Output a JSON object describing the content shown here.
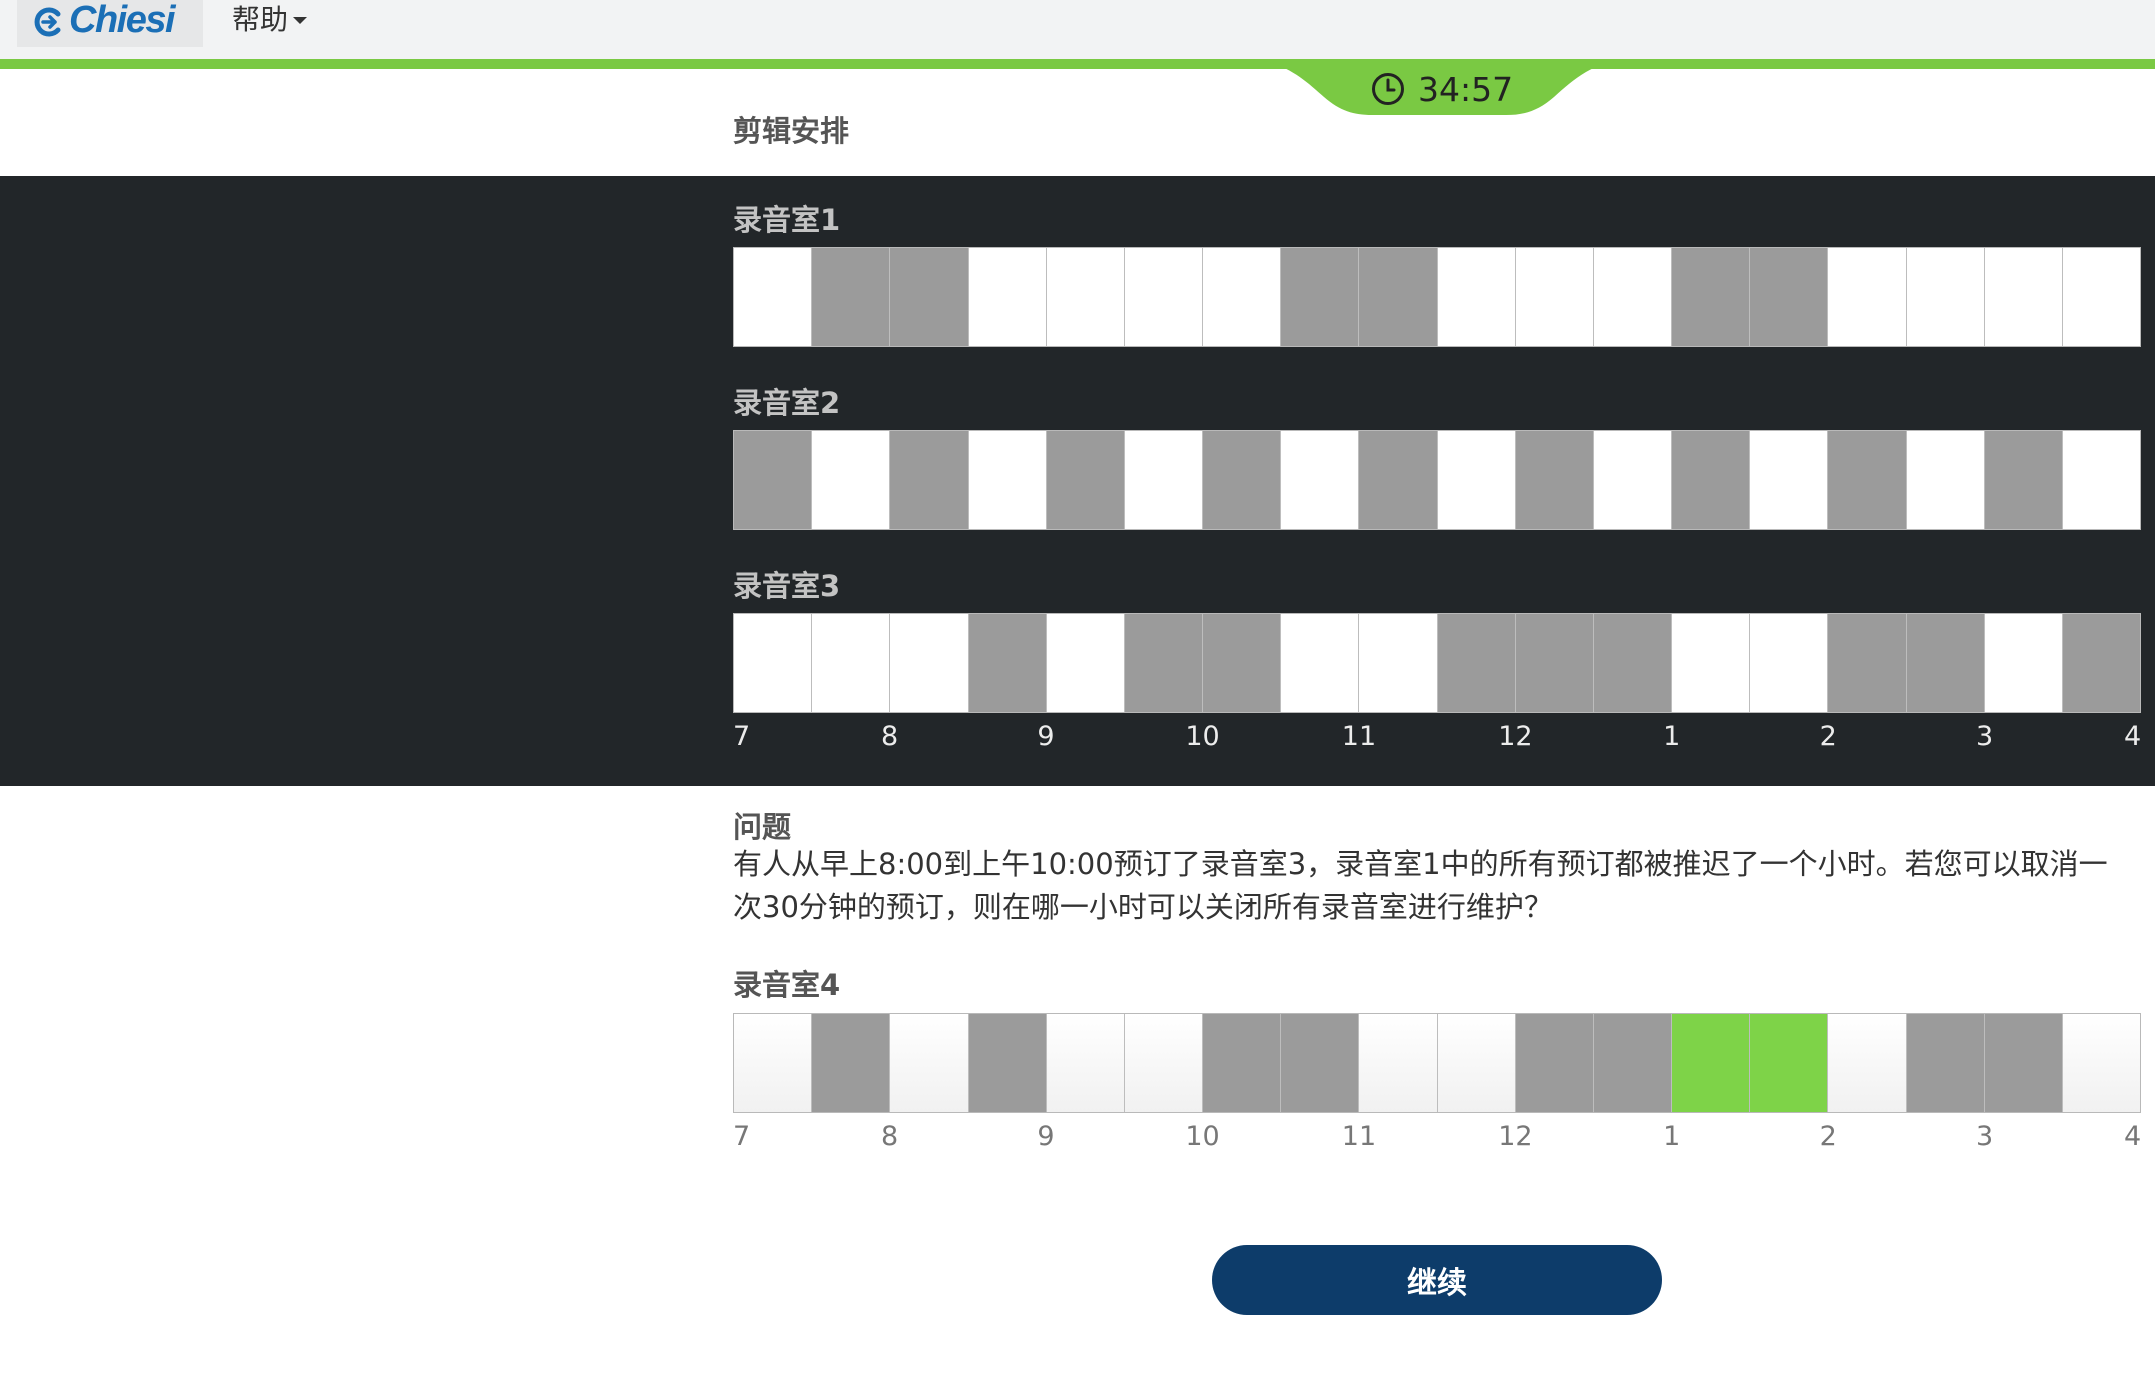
{
  "header": {
    "logo_text": "Chiesi",
    "help_menu_label": "帮助",
    "timer": "34:57"
  },
  "page_title": "剪辑安排",
  "hour_labels": [
    "7",
    "8",
    "9",
    "10",
    "11",
    "12",
    "1",
    "2",
    "3",
    "4"
  ],
  "studios": [
    {
      "label": "录音室1",
      "slots": [
        0,
        1,
        1,
        0,
        0,
        0,
        0,
        1,
        1,
        0,
        0,
        0,
        1,
        1,
        0,
        0,
        0,
        0
      ]
    },
    {
      "label": "录音室2",
      "slots": [
        1,
        0,
        1,
        0,
        1,
        0,
        1,
        0,
        1,
        0,
        1,
        0,
        1,
        0,
        1,
        0,
        1,
        0
      ]
    },
    {
      "label": "录音室3",
      "slots": [
        0,
        0,
        0,
        1,
        0,
        1,
        1,
        0,
        0,
        1,
        1,
        1,
        0,
        0,
        1,
        1,
        0,
        1
      ]
    }
  ],
  "question": {
    "heading": "问题",
    "text": "有人从早上8:00到上午10:00预订了录音室3，录音室1中的所有预订都被推迟了一个小时。若您可以取消一次30分钟的预订，则在哪一小时可以关闭所有录音室进行维护？"
  },
  "answer_studio": {
    "label": "录音室4",
    "slots": [
      0,
      1,
      0,
      1,
      0,
      0,
      1,
      1,
      0,
      0,
      1,
      1,
      2,
      2,
      0,
      1,
      1,
      0
    ]
  },
  "continue_label": "继续",
  "colors": {
    "booked": "#9b9b9b",
    "selected": "#7ed348",
    "accent_green": "#7ac943",
    "dark_panel": "#222629",
    "button": "#0d3c6a"
  }
}
